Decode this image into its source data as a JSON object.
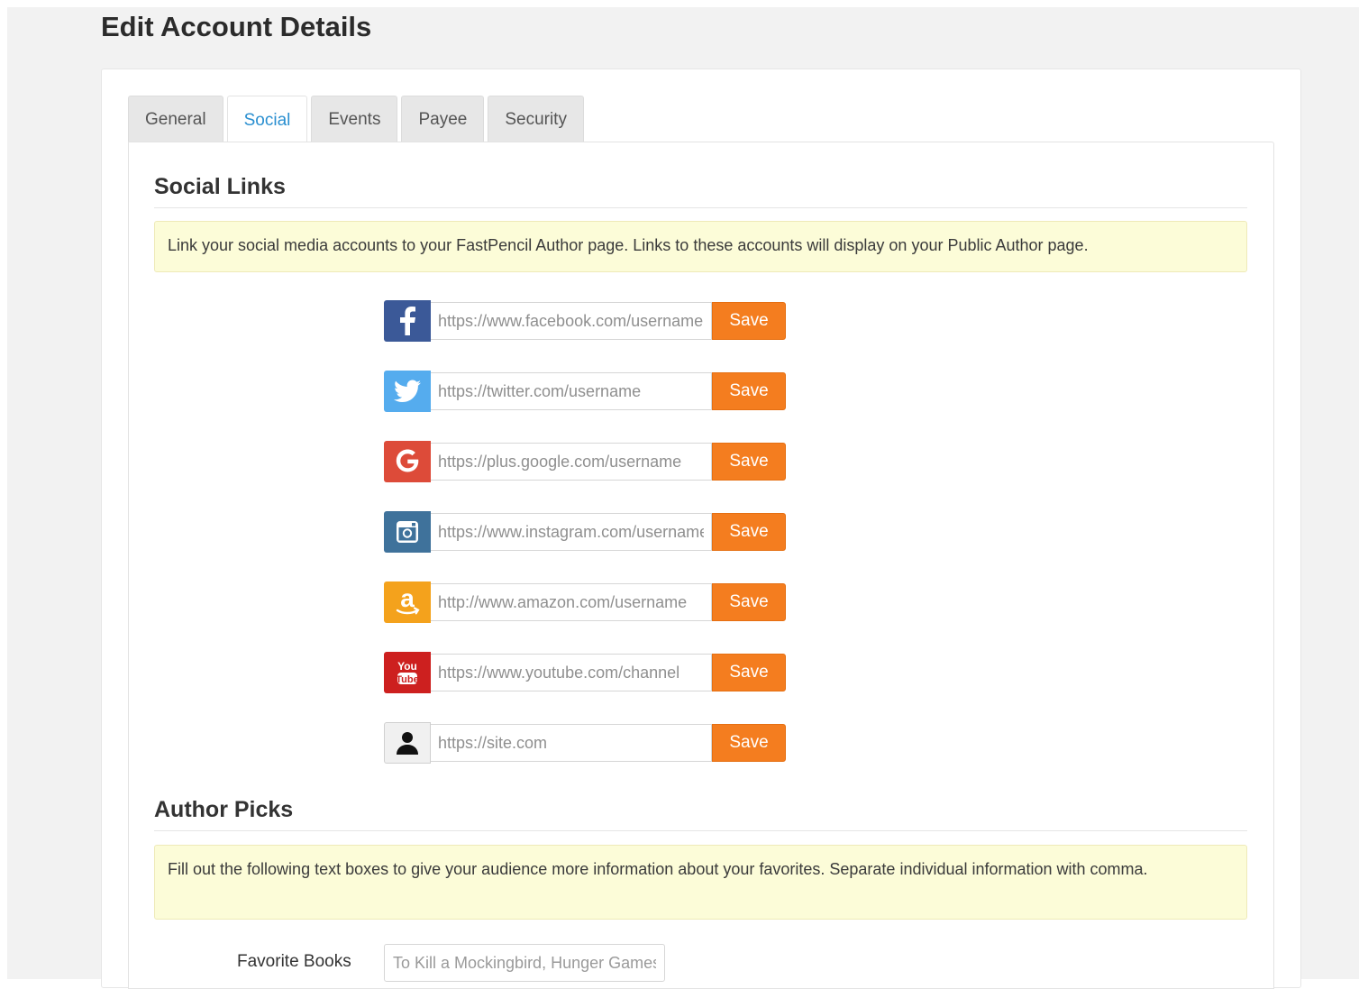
{
  "page": {
    "title": "Edit Account Details"
  },
  "tabs": [
    {
      "label": "General",
      "active": false
    },
    {
      "label": "Social",
      "active": true
    },
    {
      "label": "Events",
      "active": false
    },
    {
      "label": "Payee",
      "active": false
    },
    {
      "label": "Security",
      "active": false
    }
  ],
  "social_links": {
    "title": "Social Links",
    "notice": "Link your social media accounts to your FastPencil Author page. Links to these accounts will display on your Public Author page.",
    "save_label": "Save",
    "rows": [
      {
        "icon": "facebook-icon",
        "color": "#3b5998",
        "placeholder": "https://www.facebook.com/username"
      },
      {
        "icon": "twitter-icon",
        "color": "#55acee",
        "placeholder": "https://twitter.com/username"
      },
      {
        "icon": "google-plus-icon",
        "color": "#dd4b39",
        "placeholder": "https://plus.google.com/username"
      },
      {
        "icon": "instagram-icon",
        "color": "#3f729b",
        "placeholder": "https://www.instagram.com/username"
      },
      {
        "icon": "amazon-icon",
        "color": "#f4a21c",
        "placeholder": "http://www.amazon.com/username"
      },
      {
        "icon": "youtube-icon",
        "color": "#cd201f",
        "placeholder": "https://www.youtube.com/channel"
      },
      {
        "icon": "website-user-icon",
        "color": "#f0f0f0",
        "placeholder": "https://site.com"
      }
    ]
  },
  "author_picks": {
    "title": "Author Picks",
    "notice": "Fill out the following text boxes to give your audience more information about your favorites. Separate individual information with comma.",
    "favorite_books": {
      "label": "Favorite Books",
      "placeholder": "To Kill a Mockingbird, Hunger Games"
    }
  },
  "colors": {
    "accent_tab": "#2a8fd0",
    "save_button": "#f47d1f",
    "notice_bg": "#fcfcd8"
  }
}
